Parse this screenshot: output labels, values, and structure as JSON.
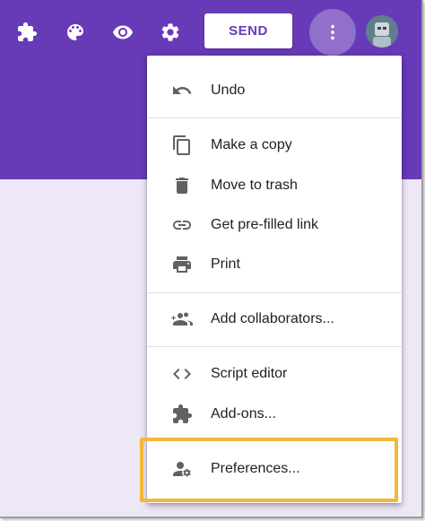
{
  "toolbar": {
    "icons": [
      "add-on-icon",
      "palette-icon",
      "eye-icon",
      "gear-icon"
    ],
    "send_label": "SEND",
    "more_icon": "more-vert-icon",
    "avatar_icon": "avatar"
  },
  "menu": {
    "items": [
      {
        "label": "Undo",
        "icon": "undo-icon"
      },
      {
        "label": "Make a copy",
        "icon": "copy-icon"
      },
      {
        "label": "Move to trash",
        "icon": "trash-icon"
      },
      {
        "label": "Get pre-filled link",
        "icon": "link-icon"
      },
      {
        "label": "Print",
        "icon": "print-icon"
      },
      {
        "label": "Add collaborators...",
        "icon": "add-people-icon"
      },
      {
        "label": "Script editor",
        "icon": "code-icon"
      },
      {
        "label": "Add-ons...",
        "icon": "puzzle-icon"
      },
      {
        "label": "Preferences...",
        "icon": "person-settings-icon"
      }
    ]
  },
  "colors": {
    "header": "#673ab7",
    "background": "#ede7f6",
    "highlight": "#f4b73a",
    "icon": "#616161"
  }
}
